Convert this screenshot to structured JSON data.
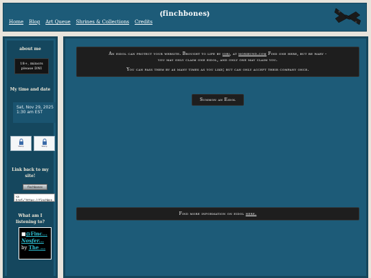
{
  "header": {
    "title": "⦅finchbones⦆",
    "nav": [
      "Home",
      "Blog",
      "Art Queue",
      "Shrines & Collections",
      "Credits"
    ]
  },
  "sidebar": {
    "about_heading": "about me",
    "about_box": [
      "18+, minors",
      "please DNI"
    ],
    "time_heading": "My time and date",
    "time_date": "Sat, Nov 29, 2025",
    "time_clock": "1:30 am EST",
    "stamps": [
      "Stamp",
      "Stamp"
    ],
    "link_heading": "Link back to my site!",
    "banner_text": "finchbones",
    "link_code": "<a href=\"https://finchbon...",
    "listening_heading": "What am I listening to?",
    "music": {
      "user": "@Finc...",
      "track": "Nosfer...",
      "by": "by",
      "artist": "The ..."
    }
  },
  "main": {
    "notice_parts": [
      "An eidol can protect your website. Brought to life by ",
      "iori",
      ", at ",
      "moribund.com",
      " Find one here, but be wary -",
      "you may only claim one eidol, and only one may claim you."
    ],
    "notice_line2": "You can pass them by as many times as you like; but can only accept their company once.",
    "summon_button": "Summon an Eidol",
    "more_info_prefix": "Find more information on eidol ",
    "more_info_link": "here."
  },
  "colors": {
    "panel_blue": "#1d5b78",
    "panel_dark": "#15475e",
    "notice_black": "#1e1e1e",
    "page_bg": "#e8e4dc"
  },
  "icons": [
    "moth-icon",
    "lock-icon"
  ]
}
